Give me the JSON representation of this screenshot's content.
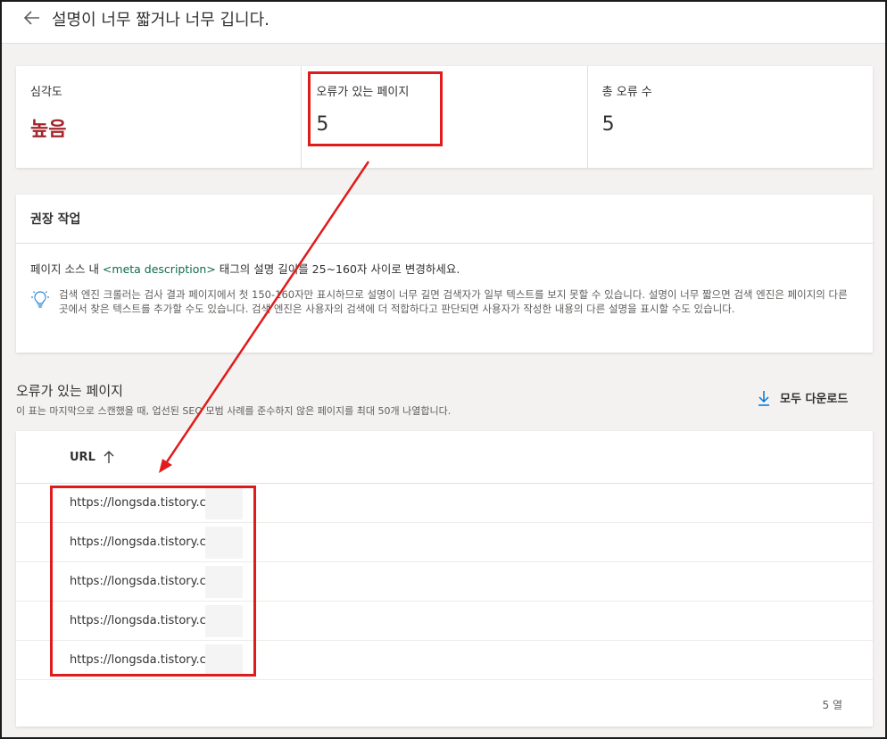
{
  "header": {
    "title": "설명이 너무 짧거나 너무 깁니다."
  },
  "stats": {
    "severity_label": "심각도",
    "severity_value": "높음",
    "pages_label": "오류가 있는 페이지",
    "pages_value": "5",
    "total_label": "총 오류 수",
    "total_value": "5"
  },
  "recommended": {
    "title": "권장 작업",
    "main_prefix": "페이지 소스 내 ",
    "main_tag": "<meta description>",
    "main_suffix": " 태그의 설명 길이를 25~160자 사이로 변경하세요.",
    "tip": "검색 엔진 크롤러는 검사 결과 페이지에서 첫 150-160자만 표시하므로 설명이 너무 길면 검색자가 일부 텍스트를 보지 못할 수 있습니다. 설명이 너무 짧으면 검색 엔진은 페이지의 다른 곳에서 찾은 텍스트를 추가할 수도 있습니다. 검색 엔진은 사용자의 검색에 더 적합하다고 판단되면 사용자가 작성한 내용의 다른 설명을 표시할 수도 있습니다."
  },
  "pages_section": {
    "title": "오류가 있는 페이지",
    "subtitle": "이 표는 마지막으로 스캔했을 때, 업선된 SEO 모범 사례를 준수하지 않은 페이지를 최대 50개 나열합니다.",
    "download_label": "모두 다운로드"
  },
  "table": {
    "column_url": "URL",
    "rows": [
      "https://longsda.tistory.co",
      "https://longsda.tistory.co",
      "https://longsda.tistory.co",
      "https://longsda.tistory.co",
      "https://longsda.tistory.co"
    ],
    "row_count": "5 열"
  },
  "colors": {
    "severity_red": "#a4262c",
    "annotation_red": "#e01b1b",
    "tag_green": "#0f6c4a"
  },
  "icons": {
    "back": "arrow-left-icon",
    "tip": "lightbulb-icon",
    "download": "download-icon",
    "sort": "arrow-up-icon"
  }
}
